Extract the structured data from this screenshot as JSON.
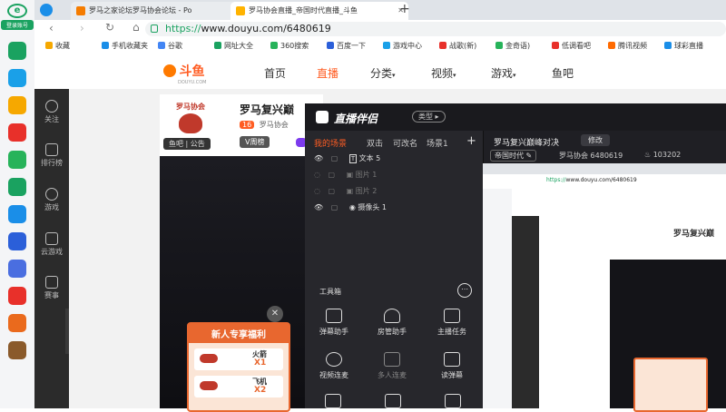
{
  "rail": {
    "brand": "登录账号",
    "apps": [
      {
        "name": "app-1",
        "color": "#1aa260"
      },
      {
        "name": "app-2",
        "color": "#1aa0e8"
      },
      {
        "name": "app-3",
        "color": "#f6a800"
      },
      {
        "name": "app-4",
        "color": "#e8302a"
      },
      {
        "name": "app-5",
        "color": "#27b35a"
      },
      {
        "name": "app-6",
        "color": "#1aa260"
      },
      {
        "name": "app-7",
        "color": "#1a8ee8"
      },
      {
        "name": "app-8",
        "color": "#2b5fd9"
      },
      {
        "name": "app-9",
        "color": "#4a6ee0"
      },
      {
        "name": "app-10",
        "color": "#e8302a"
      },
      {
        "name": "app-11",
        "color": "#ea6a1d"
      },
      {
        "name": "app-12",
        "color": "#8a5a2b"
      }
    ]
  },
  "tabs": [
    {
      "title": "罗马之家论坛罗马协会论坛 - Po",
      "active": false
    },
    {
      "title": "罗马协会直播_帝国时代直播_斗鱼",
      "active": true
    }
  ],
  "address": {
    "scheme": "https://",
    "url": "www.douyu.com/6480619"
  },
  "bookmarks": [
    {
      "label": "收藏",
      "color": "#f6a800"
    },
    {
      "label": "手机收藏夹",
      "color": "#1a8ee8"
    },
    {
      "label": "谷歌",
      "color": "#4285f4"
    },
    {
      "label": "网址大全",
      "color": "#1aa260"
    },
    {
      "label": "360搜索",
      "color": "#27b35a"
    },
    {
      "label": "百度一下",
      "color": "#2b5fd9"
    },
    {
      "label": "游戏中心",
      "color": "#1aa0e8"
    },
    {
      "label": "战歌(新)",
      "color": "#e8302a"
    },
    {
      "label": "金奇语)",
      "color": "#27b35a"
    },
    {
      "label": "低调看吧",
      "color": "#e8302a"
    },
    {
      "label": "腾讯视频",
      "color": "#ff6a00"
    },
    {
      "label": "球彩直播",
      "color": "#1a8ee8"
    }
  ],
  "site": {
    "logo": "斗鱼",
    "logo_sub": "DOUYU.COM",
    "nav": [
      "首页",
      "直播",
      "分类",
      "视频",
      "游戏",
      "鱼吧"
    ],
    "left_nav": [
      "关注",
      "排行榜",
      "游戏",
      "云游戏",
      "赛事"
    ]
  },
  "room": {
    "name": "罗马复兴巅",
    "badge": "罗马协会",
    "level": "16",
    "owner": "罗马协会",
    "rank_btn": "V周榜",
    "fish_btn": "鱼吧",
    "notice_btn": "公告"
  },
  "overlay": {
    "app_name": "直播伴侣",
    "type_btn": "类型",
    "scene_tabs": [
      "我的场景",
      "双击",
      "可改名",
      "场景1"
    ],
    "layers": [
      {
        "label": "文本 5",
        "visible": true
      },
      {
        "label": "图片 1",
        "visible": false
      },
      {
        "label": "图片 2",
        "visible": false
      },
      {
        "label": "摄像头 1",
        "visible": true
      }
    ],
    "toolbox_title": "工具箱",
    "tools": [
      "弹幕助手",
      "房管助手",
      "主播任务",
      "视频连麦",
      "多人连麦",
      "读弹幕"
    ],
    "stream_title": "罗马复兴巅峰对决",
    "edit_btn": "修改",
    "category": "帝国时代",
    "room_id": "6480619",
    "heat": "103202"
  },
  "promo": {
    "title": "新人专享福利",
    "items": [
      {
        "label": "火箭",
        "qty": "X1"
      },
      {
        "label": "飞机",
        "qty": "X2"
      }
    ]
  }
}
